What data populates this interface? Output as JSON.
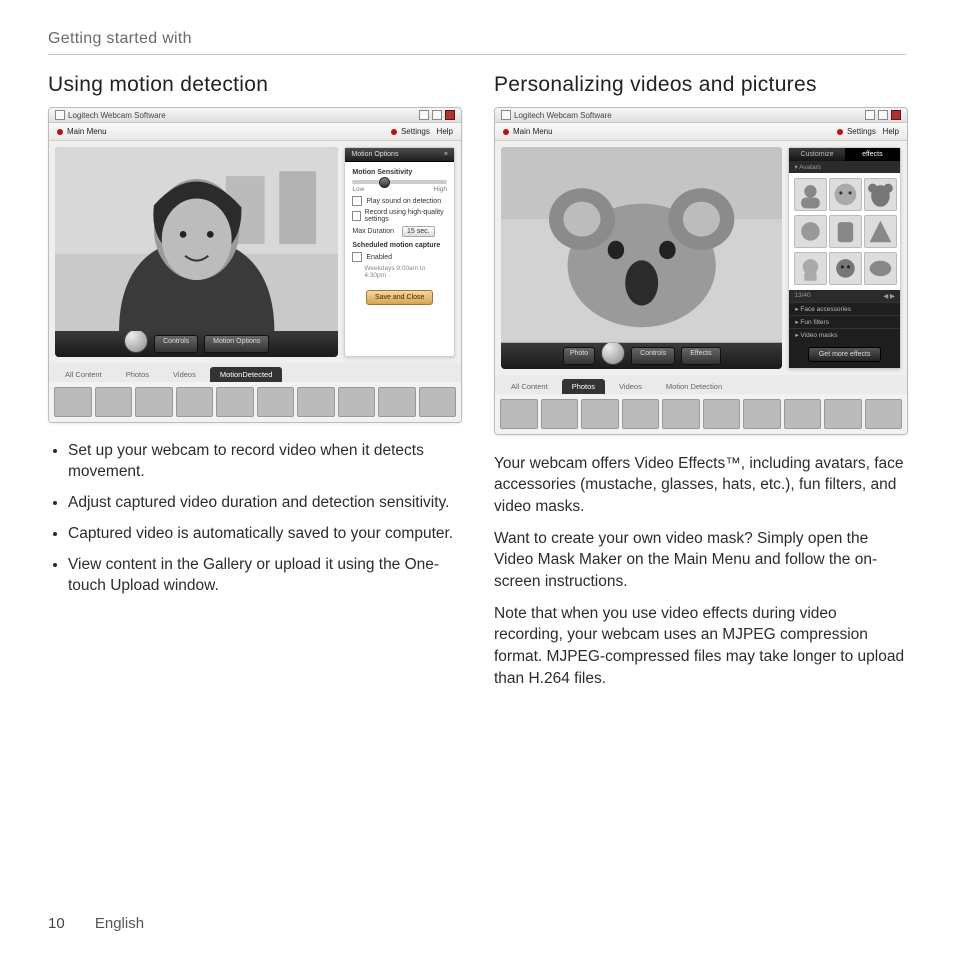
{
  "header": {
    "section": "Getting started with"
  },
  "footer": {
    "page_number": "10",
    "language": "English"
  },
  "left": {
    "title": "Using motion detection",
    "screenshot": {
      "window_title": "Logitech Webcam Software",
      "appbar": {
        "main_menu": "Main Menu",
        "settings": "Settings",
        "help": "Help"
      },
      "preview": {
        "controls_btn": "Controls",
        "motion_btn": "Motion Options"
      },
      "tabs": {
        "all": "All Content",
        "photos": "Photos",
        "videos": "Videos",
        "motion": "MotionDetected"
      },
      "panel": {
        "title": "Motion Options",
        "sensitivity_label": "Motion Sensitivity",
        "low": "Low",
        "high": "High",
        "opt1": "Play sound on detection",
        "opt2": "Record using high-quality settings",
        "max_duration_label": "Max Duration",
        "max_duration_value": "15 sec.",
        "scheduled_label": "Scheduled motion capture",
        "enabled": "Enabled",
        "schedule_hint": "Weekdays 9:00am to 4:30pm",
        "save_close": "Save and Close"
      }
    },
    "bullets": [
      "Set up your webcam to record video when it detects movement.",
      "Adjust captured video duration and detection sensitivity.",
      "Captured video is automatically saved to your computer.",
      "View content in the Gallery or upload it using the One-touch Upload window."
    ]
  },
  "right": {
    "title": "Personalizing videos and pictures",
    "screenshot": {
      "window_title": "Logitech Webcam Software",
      "appbar": {
        "main_menu": "Main Menu",
        "settings": "Settings",
        "help": "Help"
      },
      "preview": {
        "photo": "Photo",
        "capture_btn": "",
        "controls_btn": "Controls",
        "effects_btn": "Effects"
      },
      "tabs": {
        "all": "All Content",
        "photos": "Photos",
        "videos": "Videos",
        "motion": "Motion Detection"
      },
      "fx": {
        "tab_customize": "Customize",
        "tab_effects": "effects",
        "section_avatars": "Avatars",
        "counter": "13/40",
        "cat_face_accessories": "Face accessories",
        "cat_fun_filters": "Fun filters",
        "cat_video_masks": "Video masks",
        "more": "Get more effects"
      }
    },
    "paras": [
      "Your webcam offers Video Effects™, including avatars, face accessories (mustache, glasses, hats, etc.), fun filters, and video masks.",
      "Want to create your own video mask? Simply open the Video Mask Maker on the Main Menu and follow the on-screen instructions.",
      "Note that when you use video effects during video recording, your webcam uses an MJPEG compression format. MJPEG-compressed files may take longer to upload than H.264 files."
    ]
  }
}
